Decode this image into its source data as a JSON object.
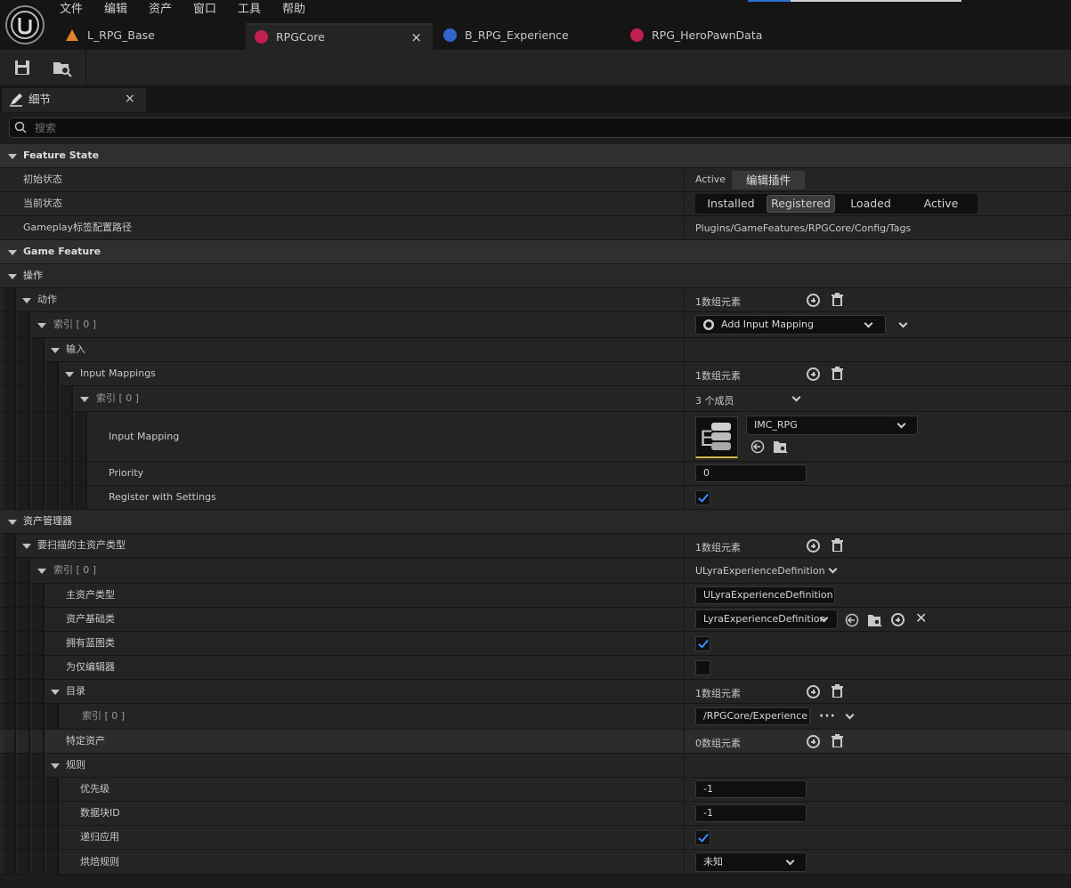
{
  "menu": [
    "文件",
    "编辑",
    "资产",
    "窗口",
    "工具",
    "帮助"
  ],
  "tabs": [
    {
      "label": "L_RPG_Base",
      "icon": "level-icon"
    },
    {
      "label": "RPGCore",
      "icon": "game-feature-icon",
      "close": "×"
    },
    {
      "label": "B_RPG_Experience",
      "icon": "blueprint-icon"
    },
    {
      "label": "RPG_HeroPawnData",
      "icon": "data-asset-icon"
    }
  ],
  "panel": {
    "title": "细节",
    "close": "×",
    "search_placeholder": "搜索"
  },
  "rows": {
    "feature_state": "Feature State",
    "initial_state": "初始状态",
    "initial_state_value": "Active",
    "edit_plugin": "编辑插件",
    "current_state": "当前状态",
    "states": [
      "Installed",
      "Registered",
      "Loaded",
      "Active"
    ],
    "selected_state": "Registered",
    "tag_path_label": "Gameplay标签配置路径",
    "tag_path_value": "Plugins/GameFeatures/RPGCore/Config/Tags",
    "game_feature": "Game Feature",
    "actions_group": "操作",
    "actions": "动作",
    "actions_count": "1数组元素",
    "index0_a": "索引 [ 0 ]",
    "action_type": "Add Input Mapping",
    "input": "输入",
    "input_mappings": "Input Mappings",
    "input_mappings_count": "1数组元素",
    "index0_b": "索引 [ 0 ]",
    "members": "3 个成员",
    "input_mapping": "Input Mapping",
    "imc_value": "IMC_RPG",
    "priority": "Priority",
    "priority_value": "0",
    "register": "Register with Settings",
    "asset_manager": "资产管理器",
    "scan_types": "要扫描的主资产类型",
    "scan_count": "1数组元素",
    "index0_c": "索引 [ 0 ]",
    "index0_c_value": "ULyraExperienceDefinition",
    "primary_type": "主资产类型",
    "primary_type_value": "ULyraExperienceDefinition",
    "base_class": "资产基础类",
    "base_class_value": "LyraExperienceDefinition",
    "has_bp": "拥有蓝图类",
    "editor_only": "为仅编辑器",
    "directories": "目录",
    "directories_count": "1数组元素",
    "index0_d": "索引 [ 0 ]",
    "dir_value": "/RPGCore/Experience",
    "specific_assets": "特定资产",
    "specific_count": "0数组元素",
    "rules": "规则",
    "priority_cn": "优先级",
    "priority_cn_value": "-1",
    "chunk_id": "数据块ID",
    "chunk_value": "-1",
    "recursive": "递归应用",
    "cook_rule": "烘焙规则",
    "cook_value": "未知"
  },
  "checks": {
    "register": true,
    "has_bp": true,
    "editor_only": false,
    "recursive": true
  },
  "colors": {
    "checkbox_accent": "#3b8cff",
    "game_feature_icon": "#c02050",
    "blueprint_icon": "#3366cc",
    "level_icon": "#e0822a",
    "thumbnail_border": "#c9b84a"
  }
}
